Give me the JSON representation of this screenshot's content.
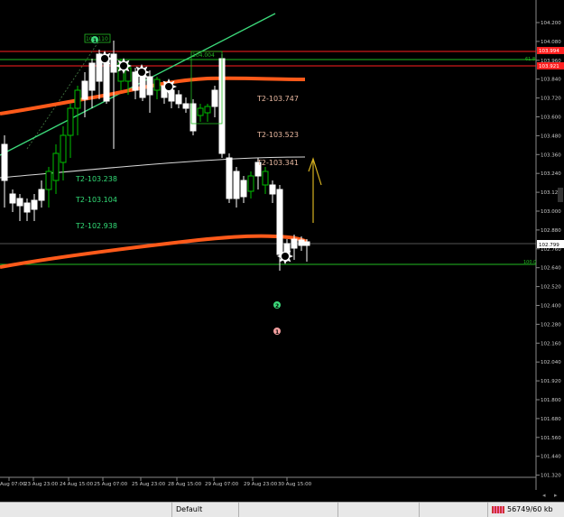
{
  "chart": {
    "price_axis": [
      "104.200",
      "104.080",
      "103.960",
      "103.840",
      "103.720",
      "103.600",
      "103.480",
      "103.360",
      "103.240",
      "103.120",
      "103.000",
      "102.880",
      "102.760",
      "102.640",
      "102.520",
      "102.400",
      "102.280",
      "102.160",
      "102.040",
      "101.920",
      "101.800",
      "101.680",
      "101.560",
      "101.440",
      "101.320"
    ],
    "time_axis": [
      "Aug 07:00",
      "23 Aug 23:00",
      "24 Aug 15:00",
      "25 Aug 07:00",
      "25 Aug 23:00",
      "28 Aug 15:00",
      "29 Aug 07:00",
      "29 Aug 23:00",
      "30 Aug 15:00"
    ],
    "current_price_label": "102.799",
    "red_price_label_1": "103.994",
    "red_price_label_2": "103.921",
    "fib_61": "61.8",
    "fib_100": "100.0",
    "box_label_1": "104.110",
    "box_label_2": "104.004",
    "targets_green": [
      "T2-103.238",
      "T2-103.104",
      "T2-102.938"
    ],
    "targets_tan": [
      "T2-103.747",
      "T2-103.523",
      "T2-103.341"
    ],
    "marker_1": "1",
    "marker_2": "2"
  },
  "status_bar": {
    "profile": "Default",
    "traffic": "56749/60 kb"
  },
  "colors": {
    "background": "#000000",
    "bull_candle": "#ffffff",
    "bear_candle": "#00c000",
    "ma_orange": "#ff5a1a",
    "trend_green": "#3cd97a",
    "fib_red": "#ff2020",
    "fib_green": "#22bb22"
  }
}
